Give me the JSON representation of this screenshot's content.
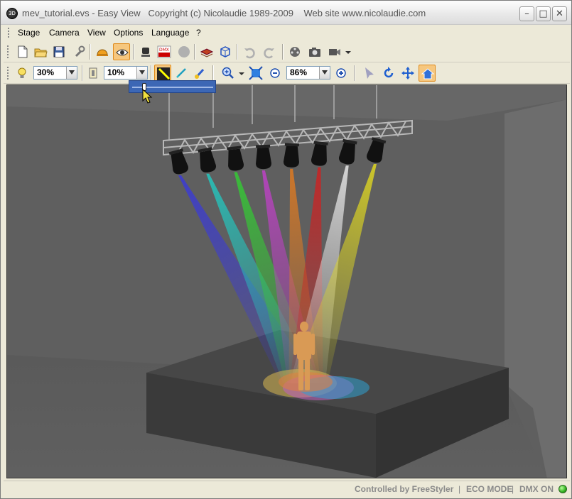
{
  "window": {
    "title": "mev_tutorial.evs - Easy View   Copyright (c) Nicolaudie 1989-2009    Web site www.nicolaudie.com",
    "app_icon_text": "3D",
    "minimize_glyph": "–",
    "maximize_glyph": "□",
    "close_glyph": "✕"
  },
  "menu": {
    "items": [
      "Stage",
      "Camera",
      "View",
      "Options",
      "Language",
      "?"
    ]
  },
  "toolbar1": {
    "icons": [
      "new-file-icon",
      "open-folder-icon",
      "save-disk-icon",
      "wrench-icon",
      "hard-hat-icon",
      "eye-view-icon",
      "moving-head-icon",
      "dmx-icon",
      "disabled-circle-icon",
      "layers-icon",
      "cube-icon",
      "undo-icon",
      "redo-icon",
      "film-reel-icon",
      "camera-icon",
      "video-camera-icon"
    ]
  },
  "toolbar2": {
    "light_combo_value": "30%",
    "fog_combo_value": "10%",
    "zoom_combo_value": "86%",
    "icons": [
      "lightbulb-icon",
      "fog-icon",
      "beam-color-icon",
      "pencil-icon",
      "brush-icon",
      "zoom-in-magnifier-icon",
      "fit-screen-icon",
      "zoom-minus-icon",
      "zoom-plus-icon",
      "pointer-icon",
      "rotate-icon",
      "pan-move-icon",
      "home-view-icon"
    ]
  },
  "slider": {
    "value_fraction": 0.12
  },
  "statusbar": {
    "controlled_by": "Controlled by FreeStyler",
    "eco_mode": "ECO MODE",
    "dmx": "DMX ON",
    "separator": "|"
  },
  "scene": {
    "beam_colors": [
      "#3a3ad8",
      "#22c8c0",
      "#33cc33",
      "#c040c8",
      "#e07a20",
      "#d02020",
      "#e8e8e8",
      "#e0d820"
    ],
    "spot_colors": [
      "#d9b850",
      "#c060c0",
      "#30a0d0",
      "#e08040"
    ]
  }
}
